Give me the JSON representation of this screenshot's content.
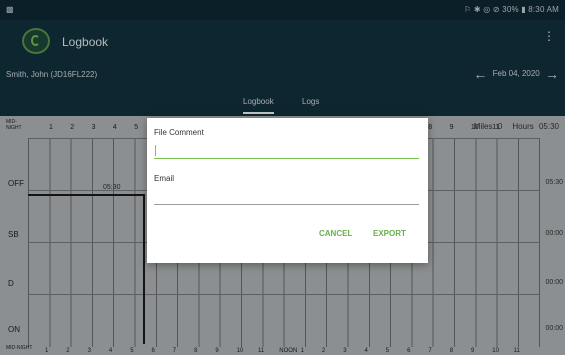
{
  "status_bar": {
    "left_icon": "notification-icon",
    "right_text": "⚐ ✱ ◎ ⊘ 30% ▮ 8:30 AM"
  },
  "app_bar": {
    "title": "Logbook",
    "menu_icon": "⋮"
  },
  "sub_bar": {
    "driver": "Smith, John (JD16FL222)",
    "date": "Feb 04, 2020",
    "prev_arrow": "←",
    "next_arrow": "→"
  },
  "tabs": [
    {
      "label": "Logbook",
      "active": true
    },
    {
      "label": "Logs",
      "active": false
    }
  ],
  "chart": {
    "miles_label": "Miles",
    "miles_value": "0",
    "hours_label": "Hours",
    "hours_value": "05:30",
    "mid_label": "MID-NIGHT",
    "top_hours": [
      "1",
      "2",
      "3",
      "4",
      "5",
      "6",
      "7",
      "8",
      "9",
      "10",
      "11"
    ],
    "bottom_hours": [
      "1",
      "2",
      "3",
      "4",
      "5",
      "6",
      "7",
      "8",
      "9",
      "10",
      "11",
      "NOON",
      "1",
      "2",
      "3",
      "4",
      "5",
      "6",
      "7",
      "8",
      "9",
      "10",
      "11"
    ],
    "time_marker": "05:30",
    "rows": [
      {
        "status": "OFF",
        "total": "05:30"
      },
      {
        "status": "SB",
        "total": "00:00"
      },
      {
        "status": "D",
        "total": "00:00"
      },
      {
        "status": "ON",
        "total": "00:00"
      }
    ]
  },
  "dialog": {
    "file_comment_label": "File Comment",
    "file_comment_value": "",
    "email_label": "Email",
    "email_value": "",
    "cancel_label": "CANCEL",
    "export_label": "EXPORT"
  },
  "colors": {
    "app_bar": "#123340",
    "accent": "#7cc24f",
    "button": "#6ab04c"
  }
}
